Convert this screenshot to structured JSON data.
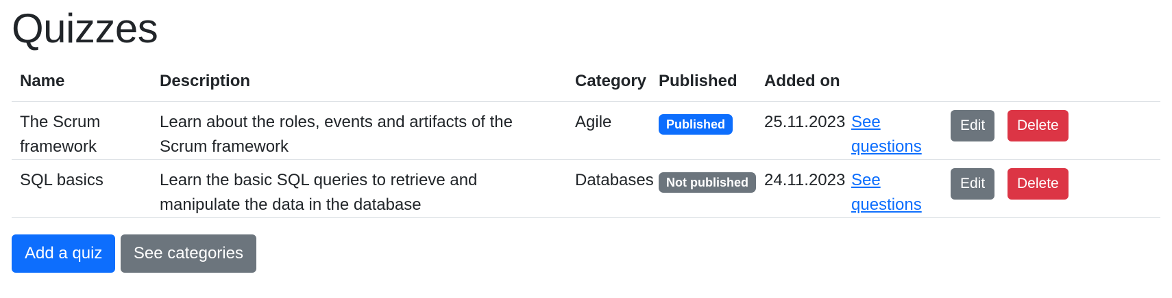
{
  "page": {
    "title": "Quizzes"
  },
  "table": {
    "headers": {
      "name": "Name",
      "description": "Description",
      "category": "Category",
      "published": "Published",
      "added_on": "Added on"
    },
    "rows": [
      {
        "name": "The Scrum framework",
        "description": "Learn about the roles, events and artifacts of the Scrum framework",
        "category": "Agile",
        "published": "Published",
        "published_state": true,
        "added_on": "25.11.2023",
        "see_questions": "See questions",
        "edit": "Edit",
        "delete": "Delete"
      },
      {
        "name": "SQL basics",
        "description": "Learn the basic SQL queries to retrieve and manipulate the data in the database",
        "category": "Databases",
        "published": "Not published",
        "published_state": false,
        "added_on": "24.11.2023",
        "see_questions": "See questions",
        "edit": "Edit",
        "delete": "Delete"
      }
    ]
  },
  "actions": {
    "add_quiz": "Add a quiz",
    "see_categories": "See categories"
  },
  "colors": {
    "primary": "#0d6efd",
    "secondary": "#6c757d",
    "danger": "#dc3545",
    "text": "#212529",
    "border": "#dee2e6"
  }
}
